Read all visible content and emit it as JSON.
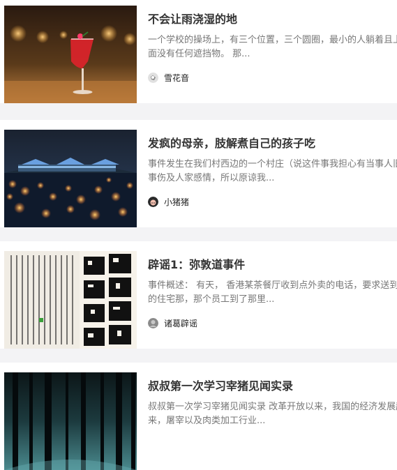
{
  "articles": [
    {
      "title": "不会让雨浇湿的地",
      "summary": "一个学校的操场上，有三个位置，三个圆圈，最小的人躺着且上面没有任何遮挡物。 那...",
      "author": "雪花音",
      "thumbnail_icon": "cocktail-glass-image",
      "avatar_icon": "avatar-snowflake"
    },
    {
      "title": "发疯的母亲，肢解煮自己的孩子吃",
      "summary": "事件发生在我们村西边的一个村庄（说这件事我担心有当事人旧事伤及人家感情，所以原谅我...",
      "author": "小猪猪",
      "thumbnail_icon": "river-lanterns-bridge-image",
      "avatar_icon": "avatar-pig"
    },
    {
      "title": "辟谣1：弥敦道事件",
      "summary": "事件概述： 有天， 香港某茶餐厅收到点外卖的电话，要求送到的住宅那，那个员工到了那里...",
      "author": "诸葛辟谣",
      "thumbnail_icon": "newspaper-clipping-image",
      "avatar_icon": "avatar-gray"
    },
    {
      "title": "叔叔第一次学习宰猪见闻实录",
      "summary": "叔叔第一次学习宰猪见闻实录 改革开放以来，我国的经济发展起来，屠宰以及肉类加工行业...",
      "author": "",
      "thumbnail_icon": "dark-forest-image",
      "avatar_icon": ""
    }
  ]
}
